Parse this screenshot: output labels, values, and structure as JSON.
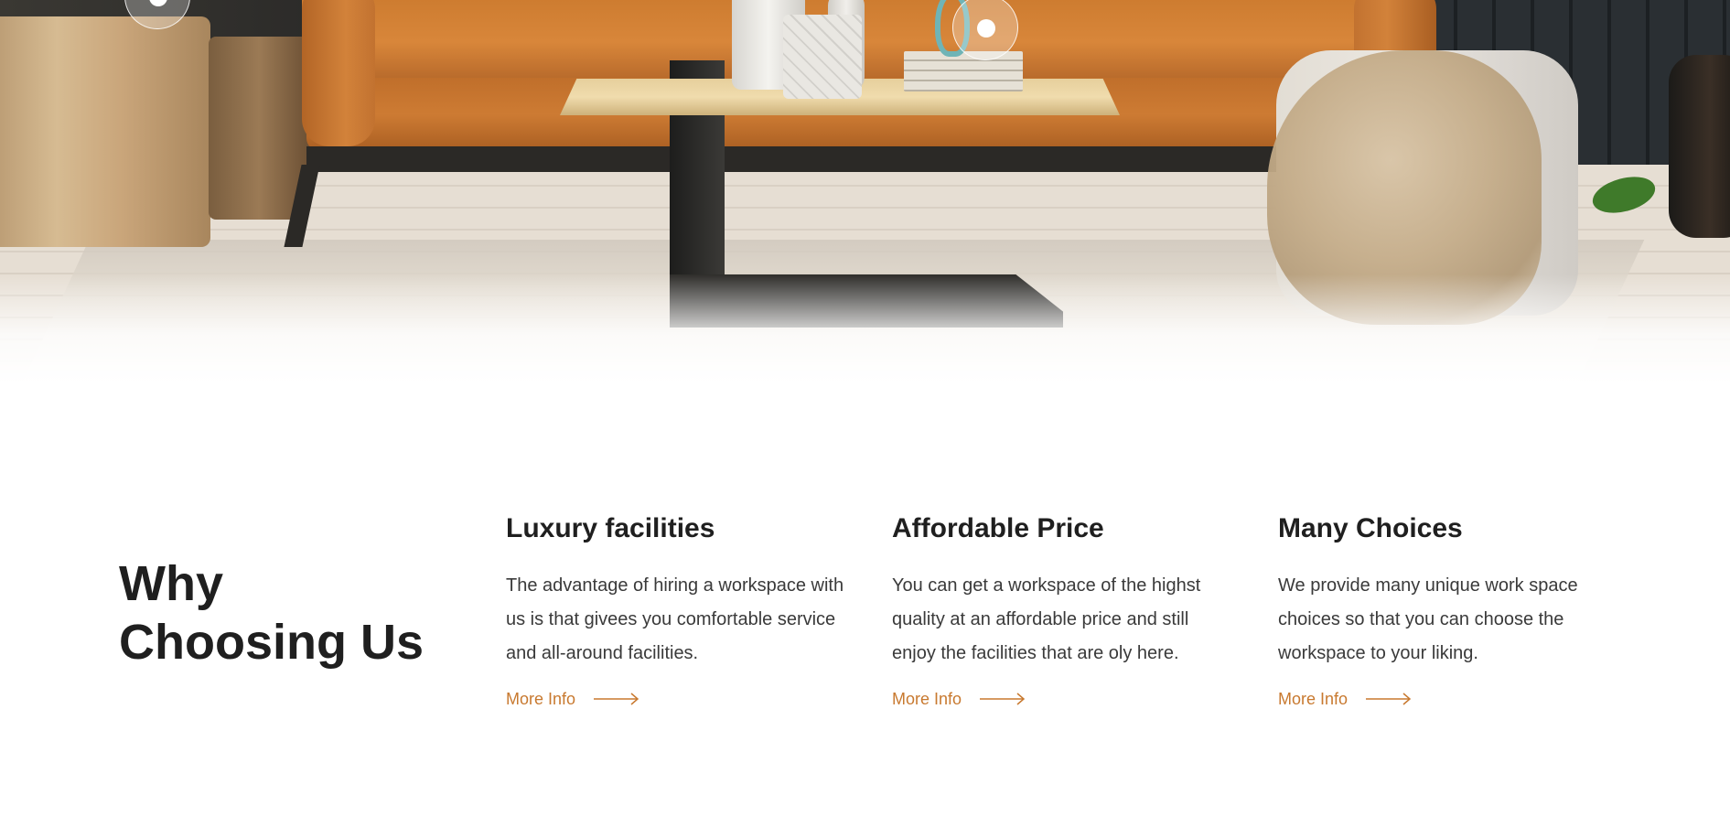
{
  "hero": {
    "hotspots": [
      {
        "icon": "hotspot-dot-icon"
      },
      {
        "icon": "hotspot-dot-icon"
      }
    ]
  },
  "why": {
    "title_line1": "Why",
    "title_line2": "Choosing Us"
  },
  "features": [
    {
      "title": "Luxury facilities",
      "text": "The advantage of hiring a workspace with us is that givees you comfortable service and all-around facilities.",
      "link_label": "More Info",
      "link_icon": "arrow-right-icon"
    },
    {
      "title": "Affordable Price",
      "text": "You can get a workspace of the highst quality at an affordable price and still enjoy the facilities that are oly here.",
      "link_label": "More Info",
      "link_icon": "arrow-right-icon"
    },
    {
      "title": "Many Choices",
      "text": "We provide many unique work space choices so that you can choose the workspace to your liking.",
      "link_label": "More Info",
      "link_icon": "arrow-right-icon"
    }
  ],
  "colors": {
    "accent": "#c8792f",
    "heading": "#1f1f1f",
    "body_text": "#3a3a3a"
  }
}
